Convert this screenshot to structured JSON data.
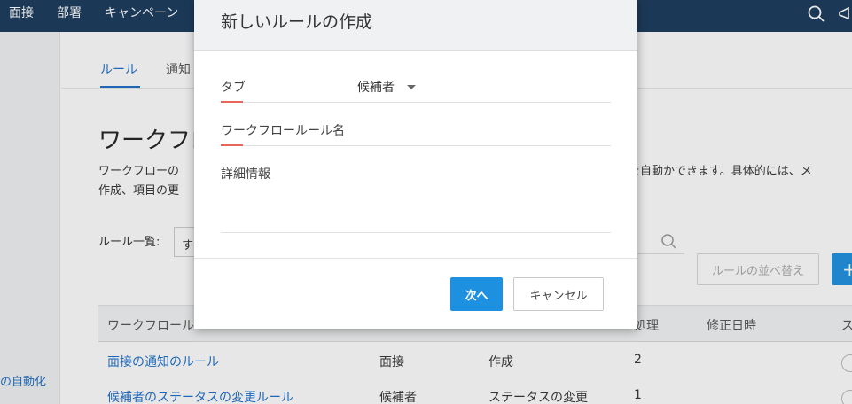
{
  "topbar": {
    "nav": [
      "面接",
      "部署",
      "キャンペーン"
    ],
    "icons": [
      "search-icon",
      "megaphone-icon"
    ],
    "color": "#17395c"
  },
  "sidebar": {
    "link": "の自動化"
  },
  "tabs": [
    {
      "label": "ルール",
      "active": true
    },
    {
      "label": "通知",
      "active": false
    }
  ],
  "page": {
    "title": "ワークフロ",
    "desc_line1": "ワークフローの",
    "desc_line1_right": "を自動かできます。具体的には、メ",
    "desc_line2": "作成、項目の更",
    "list_label": "ルール一覧:",
    "list_select": "す",
    "sort_button": "ルールの並べ替え",
    "add_button": "+"
  },
  "table": {
    "headers": [
      "ワークフロール",
      "処理",
      "修正日時",
      "ス"
    ],
    "rows": [
      {
        "name": "面接の通知のルール",
        "tab": "面接",
        "trigger": "作成",
        "count": "2"
      },
      {
        "name": "候補者のステータスの変更ルール",
        "tab": "候補者",
        "trigger": "ステータスの変更",
        "count": "1"
      }
    ]
  },
  "modal": {
    "title": "新しいルールの作成",
    "fields": {
      "tab_label": "タブ",
      "tab_value": "候補者",
      "rule_name_label": "ワークフロールール名",
      "details_label": "詳細情報"
    },
    "next_button": "次へ",
    "cancel_button": "キャンセル",
    "accent_color": "#1e90e0",
    "required_color": "#e8675a"
  }
}
